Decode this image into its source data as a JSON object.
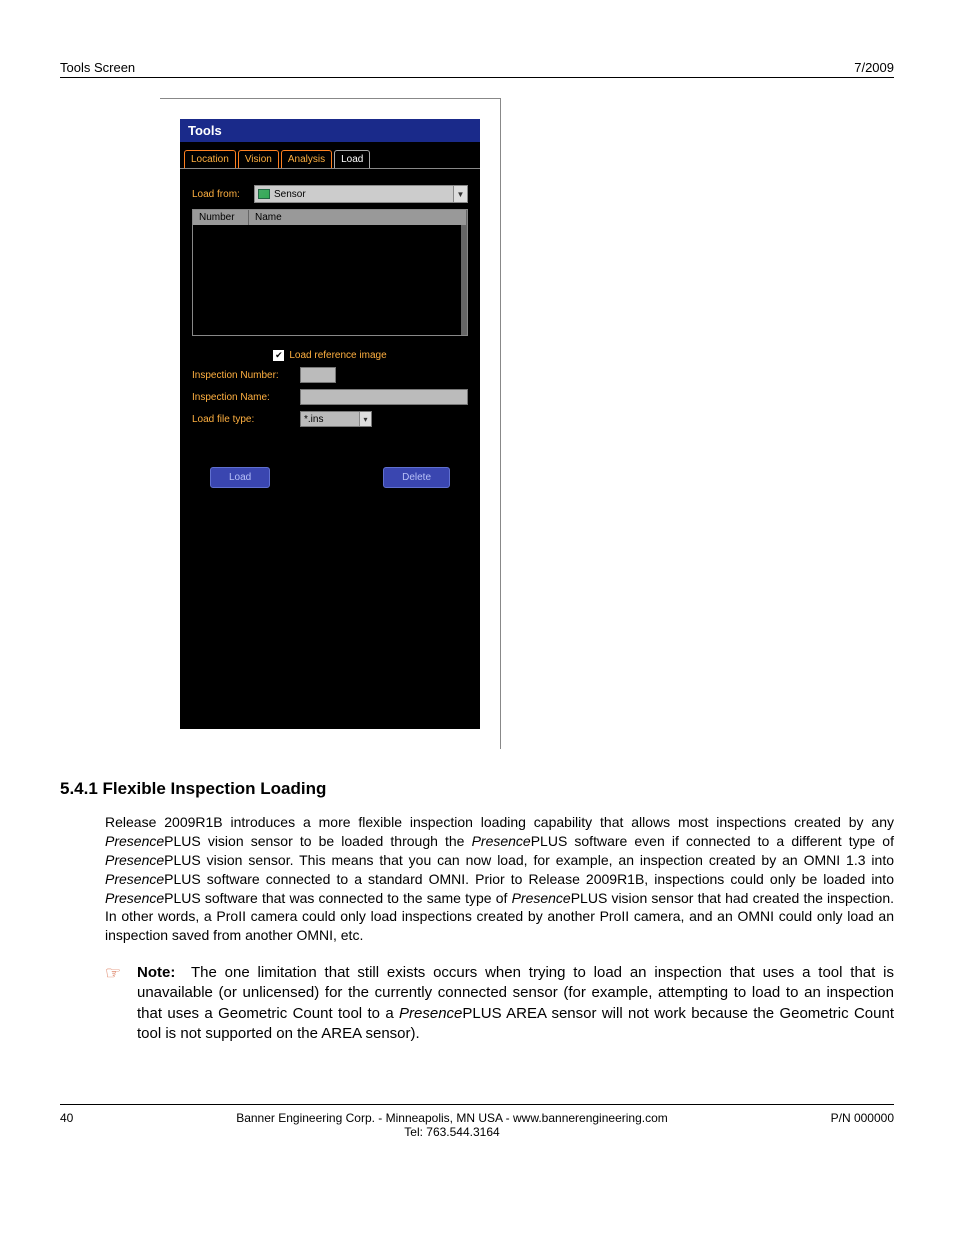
{
  "header": {
    "left": "Tools Screen",
    "right": "7/2009"
  },
  "panel": {
    "title": "Tools",
    "tabs": [
      "Location",
      "Vision",
      "Analysis",
      "Load"
    ],
    "active_tab": 3,
    "load_from_label": "Load from:",
    "load_from_value": "Sensor",
    "columns": {
      "number": "Number",
      "name": "Name"
    },
    "checkbox_label": "Load reference image",
    "checkbox_checked": true,
    "inspection_number_label": "Inspection Number:",
    "inspection_name_label": "Inspection Name:",
    "load_file_type_label": "Load file type:",
    "load_file_type_value": "*.ins",
    "load_btn": "Load",
    "delete_btn": "Delete"
  },
  "section": {
    "heading": "5.4.1 Flexible Inspection Loading",
    "p1a": "Release 2009R1B introduces a more flexible inspection loading capability that allows most inspections created by any ",
    "p1b": "PLUS vision sensor to be loaded through the ",
    "p1c": "PLUS software even if connected to a different type of ",
    "p1d": "PLUS vision sensor. This means that you can now load, for example, an inspection created by an OMNI 1.3 into ",
    "p1e": "PLUS software connected to a standard OMNI. Prior to Release 2009R1B, inspections could only be loaded into ",
    "p1f": "PLUS software that was connected to the same type of ",
    "p1g": "PLUS vision sensor that had created the inspection. In other words, a ProII camera could only load inspections created by another ProII camera, and an OMNI could only load an inspection saved from another OMNI, etc.",
    "presence": "Presence",
    "note_label": "Note:",
    "note_a": "The one limitation that still exists occurs when trying to load an inspection that uses a tool that is unavailable (or unlicensed) for the currently connected sensor (for example, attempting to load to an inspection that uses a Geometric Count tool to a ",
    "note_b": "PLUS AREA sensor will not work because the Geometric Count tool is not supported on the AREA sensor)."
  },
  "footer": {
    "page": "40",
    "center1": "Banner Engineering Corp. - Minneapolis, MN USA - www.bannerengineering.com",
    "center2": "Tel: 763.544.3164",
    "right": "P/N 000000"
  }
}
